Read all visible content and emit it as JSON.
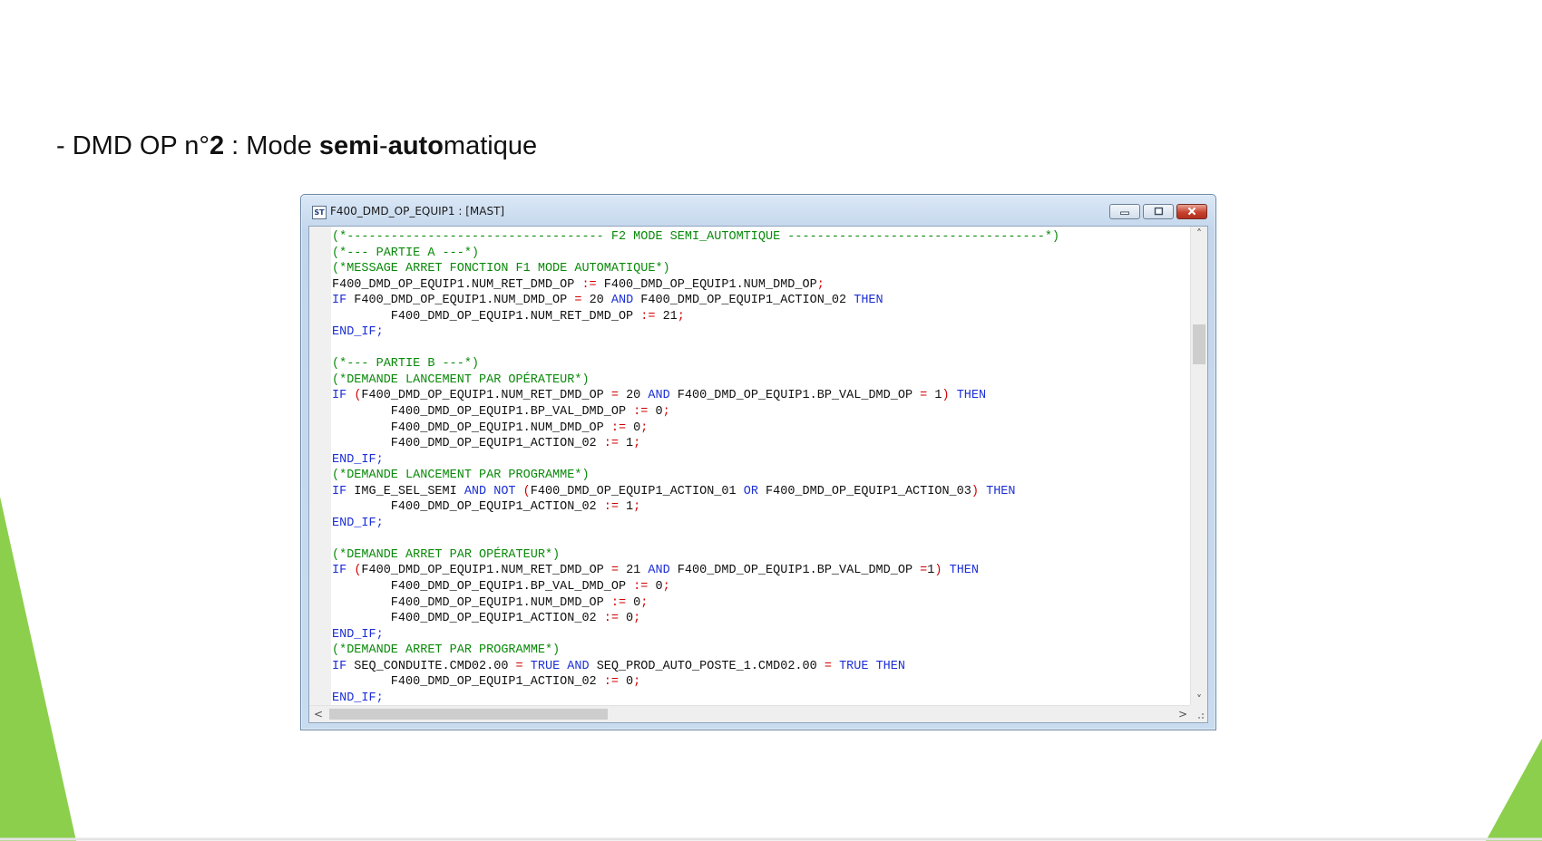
{
  "slide": {
    "heading_segments": [
      {
        "text": "- DMD OP n°",
        "bold": false
      },
      {
        "text": "2",
        "bold": true
      },
      {
        "text": " : Mode ",
        "bold": false
      },
      {
        "text": "semi",
        "bold": true
      },
      {
        "text": "-",
        "bold": false
      },
      {
        "text": "auto",
        "bold": true
      },
      {
        "text": "matique",
        "bold": false
      }
    ]
  },
  "window": {
    "icon_text": "ST",
    "title": "F400_DMD_OP_EQUIP1 : [MAST]",
    "controls": {
      "minimize_icon": "minimize-icon",
      "maximize_icon": "maximize-icon",
      "close_icon": "close-icon"
    }
  },
  "colors": {
    "comment": "#0a8a0a",
    "keyword": "#1d2fd6",
    "operator": "#d20000",
    "text": "#111111",
    "slide_accent_green": "#8ccf4d",
    "close_button": "#c8422e"
  },
  "editor": {
    "lines": [
      [
        {
          "t": "(*----------------------------------- F2 MODE SEMI_AUTOMTIQUE -----------------------------------*)",
          "k": "comment"
        }
      ],
      [
        {
          "t": "(*--- PARTIE A ---*)",
          "k": "comment"
        }
      ],
      [
        {
          "t": "(*MESSAGE ARRET FONCTION F1 MODE AUTOMATIQUE*)",
          "k": "comment"
        }
      ],
      [
        {
          "t": "F400_DMD_OP_EQUIP1.NUM_RET_DMD_OP ",
          "k": "text"
        },
        {
          "t": ":=",
          "k": "operator"
        },
        {
          "t": " F400_DMD_OP_EQUIP1.NUM_DMD_OP",
          "k": "text"
        },
        {
          "t": ";",
          "k": "operator"
        }
      ],
      [
        {
          "t": "IF",
          "k": "keyword"
        },
        {
          "t": " F400_DMD_OP_EQUIP1.NUM_DMD_OP ",
          "k": "text"
        },
        {
          "t": "=",
          "k": "operator"
        },
        {
          "t": " 20 ",
          "k": "text"
        },
        {
          "t": "AND",
          "k": "keyword"
        },
        {
          "t": " F400_DMD_OP_EQUIP1_ACTION_02 ",
          "k": "text"
        },
        {
          "t": "THEN",
          "k": "keyword"
        }
      ],
      [
        {
          "t": "        F400_DMD_OP_EQUIP1.NUM_RET_DMD_OP ",
          "k": "text"
        },
        {
          "t": ":=",
          "k": "operator"
        },
        {
          "t": " 21",
          "k": "text"
        },
        {
          "t": ";",
          "k": "operator"
        }
      ],
      [
        {
          "t": "END_IF;",
          "k": "keyword"
        }
      ],
      [
        {
          "t": "",
          "k": "text"
        }
      ],
      [
        {
          "t": "(*--- PARTIE B ---*)",
          "k": "comment"
        }
      ],
      [
        {
          "t": "(*DEMANDE LANCEMENT PAR OPÉRATEUR*)",
          "k": "comment"
        }
      ],
      [
        {
          "t": "IF",
          "k": "keyword"
        },
        {
          "t": " ",
          "k": "text"
        },
        {
          "t": "(",
          "k": "operator"
        },
        {
          "t": "F400_DMD_OP_EQUIP1.NUM_RET_DMD_OP ",
          "k": "text"
        },
        {
          "t": "=",
          "k": "operator"
        },
        {
          "t": " 20 ",
          "k": "text"
        },
        {
          "t": "AND",
          "k": "keyword"
        },
        {
          "t": " F400_DMD_OP_EQUIP1.BP_VAL_DMD_OP ",
          "k": "text"
        },
        {
          "t": "=",
          "k": "operator"
        },
        {
          "t": " 1",
          "k": "text"
        },
        {
          "t": ")",
          "k": "operator"
        },
        {
          "t": " ",
          "k": "text"
        },
        {
          "t": "THEN",
          "k": "keyword"
        }
      ],
      [
        {
          "t": "        F400_DMD_OP_EQUIP1.BP_VAL_DMD_OP ",
          "k": "text"
        },
        {
          "t": ":=",
          "k": "operator"
        },
        {
          "t": " 0",
          "k": "text"
        },
        {
          "t": ";",
          "k": "operator"
        }
      ],
      [
        {
          "t": "        F400_DMD_OP_EQUIP1.NUM_DMD_OP ",
          "k": "text"
        },
        {
          "t": ":=",
          "k": "operator"
        },
        {
          "t": " 0",
          "k": "text"
        },
        {
          "t": ";",
          "k": "operator"
        }
      ],
      [
        {
          "t": "        F400_DMD_OP_EQUIP1_ACTION_02 ",
          "k": "text"
        },
        {
          "t": ":=",
          "k": "operator"
        },
        {
          "t": " 1",
          "k": "text"
        },
        {
          "t": ";",
          "k": "operator"
        }
      ],
      [
        {
          "t": "END_IF;",
          "k": "keyword"
        }
      ],
      [
        {
          "t": "(*DEMANDE LANCEMENT PAR PROGRAMME*)",
          "k": "comment"
        }
      ],
      [
        {
          "t": "IF",
          "k": "keyword"
        },
        {
          "t": " IMG_E_SEL_SEMI ",
          "k": "text"
        },
        {
          "t": "AND NOT",
          "k": "keyword"
        },
        {
          "t": " ",
          "k": "text"
        },
        {
          "t": "(",
          "k": "operator"
        },
        {
          "t": "F400_DMD_OP_EQUIP1_ACTION_01 ",
          "k": "text"
        },
        {
          "t": "OR",
          "k": "keyword"
        },
        {
          "t": " F400_DMD_OP_EQUIP1_ACTION_03",
          "k": "text"
        },
        {
          "t": ")",
          "k": "operator"
        },
        {
          "t": " ",
          "k": "text"
        },
        {
          "t": "THEN",
          "k": "keyword"
        }
      ],
      [
        {
          "t": "        F400_DMD_OP_EQUIP1_ACTION_02 ",
          "k": "text"
        },
        {
          "t": ":=",
          "k": "operator"
        },
        {
          "t": " 1",
          "k": "text"
        },
        {
          "t": ";",
          "k": "operator"
        }
      ],
      [
        {
          "t": "END_IF;",
          "k": "keyword"
        }
      ],
      [
        {
          "t": "",
          "k": "text"
        }
      ],
      [
        {
          "t": "(*DEMANDE ARRET PAR OPÉRATEUR*)",
          "k": "comment"
        }
      ],
      [
        {
          "t": "IF",
          "k": "keyword"
        },
        {
          "t": " ",
          "k": "text"
        },
        {
          "t": "(",
          "k": "operator"
        },
        {
          "t": "F400_DMD_OP_EQUIP1.NUM_RET_DMD_OP ",
          "k": "text"
        },
        {
          "t": "=",
          "k": "operator"
        },
        {
          "t": " 21 ",
          "k": "text"
        },
        {
          "t": "AND",
          "k": "keyword"
        },
        {
          "t": " F400_DMD_OP_EQUIP1.BP_VAL_DMD_OP ",
          "k": "text"
        },
        {
          "t": "=",
          "k": "operator"
        },
        {
          "t": "1",
          "k": "text"
        },
        {
          "t": ")",
          "k": "operator"
        },
        {
          "t": " ",
          "k": "text"
        },
        {
          "t": "THEN",
          "k": "keyword"
        }
      ],
      [
        {
          "t": "        F400_DMD_OP_EQUIP1.BP_VAL_DMD_OP ",
          "k": "text"
        },
        {
          "t": ":=",
          "k": "operator"
        },
        {
          "t": " 0",
          "k": "text"
        },
        {
          "t": ";",
          "k": "operator"
        }
      ],
      [
        {
          "t": "        F400_DMD_OP_EQUIP1.NUM_DMD_OP ",
          "k": "text"
        },
        {
          "t": ":=",
          "k": "operator"
        },
        {
          "t": " 0",
          "k": "text"
        },
        {
          "t": ";",
          "k": "operator"
        }
      ],
      [
        {
          "t": "        F400_DMD_OP_EQUIP1_ACTION_02 ",
          "k": "text"
        },
        {
          "t": ":=",
          "k": "operator"
        },
        {
          "t": " 0",
          "k": "text"
        },
        {
          "t": ";",
          "k": "operator"
        }
      ],
      [
        {
          "t": "END_IF;",
          "k": "keyword"
        }
      ],
      [
        {
          "t": "(*DEMANDE ARRET PAR PROGRAMME*)",
          "k": "comment"
        }
      ],
      [
        {
          "t": "IF",
          "k": "keyword"
        },
        {
          "t": " SEQ_CONDUITE.CMD02.00 ",
          "k": "text"
        },
        {
          "t": "=",
          "k": "operator"
        },
        {
          "t": " ",
          "k": "text"
        },
        {
          "t": "TRUE",
          "k": "keyword"
        },
        {
          "t": " ",
          "k": "text"
        },
        {
          "t": "AND",
          "k": "keyword"
        },
        {
          "t": " SEQ_PROD_AUTO_POSTE_1.CMD02.00 ",
          "k": "text"
        },
        {
          "t": "=",
          "k": "operator"
        },
        {
          "t": " ",
          "k": "text"
        },
        {
          "t": "TRUE",
          "k": "keyword"
        },
        {
          "t": " ",
          "k": "text"
        },
        {
          "t": "THEN",
          "k": "keyword"
        }
      ],
      [
        {
          "t": "        F400_DMD_OP_EQUIP1_ACTION_02 ",
          "k": "text"
        },
        {
          "t": ":=",
          "k": "operator"
        },
        {
          "t": " 0",
          "k": "text"
        },
        {
          "t": ";",
          "k": "operator"
        }
      ],
      [
        {
          "t": "END_IF;",
          "k": "keyword"
        }
      ]
    ]
  },
  "scrollbars": {
    "vertical": {
      "up_arrow": "˄",
      "down_arrow": "˅",
      "position_fraction": 0.2,
      "thumb_fraction": 0.09,
      "up_icon": "chevron-up-icon",
      "down_icon": "chevron-down-icon"
    },
    "horizontal": {
      "left_arrow": "<",
      "right_arrow": ">",
      "position_fraction": 0.0,
      "thumb_fraction": 0.33,
      "left_icon": "chevron-left-icon",
      "right_icon": "chevron-right-icon"
    },
    "grip_icon": "resize-grip-icon"
  }
}
